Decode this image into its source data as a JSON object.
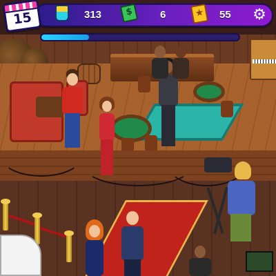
{
  "hud": {
    "level": "15",
    "progress_fraction": 0.24,
    "resources": [
      {
        "name": "cups",
        "icon": "coffee-cup-icon",
        "value": "313"
      },
      {
        "name": "cash",
        "icon": "cash-icon",
        "value": "6"
      },
      {
        "name": "tickets",
        "icon": "star-ticket-icon",
        "value": "55"
      }
    ],
    "settings_icon": "gear-icon"
  },
  "colors": {
    "hud_start": "#2b1d8a",
    "hud_end": "#8e1bd0",
    "progress": "#2ad3ff",
    "carpet": "#c0221c"
  }
}
